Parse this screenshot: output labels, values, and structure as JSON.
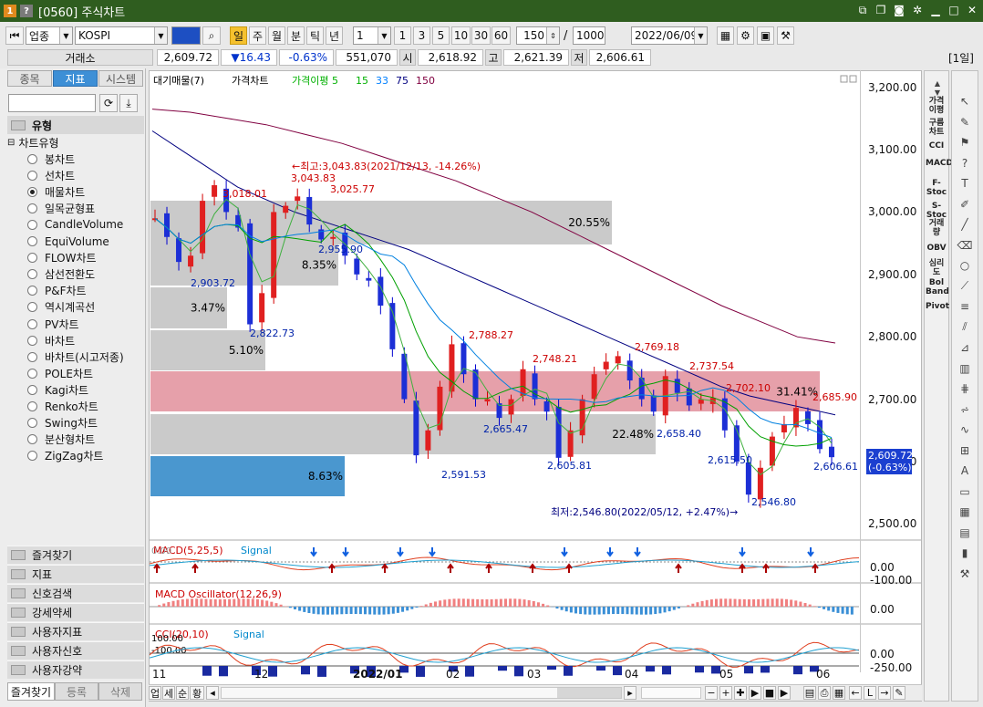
{
  "window": {
    "title": "[0560] 주식차트",
    "icon_left": "1",
    "icon_help": "?"
  },
  "toolbar": {
    "category": "업종",
    "symbol": "KOSPI",
    "period_selected": "일",
    "periods": [
      "일",
      "주",
      "월",
      "분",
      "틱",
      "년"
    ],
    "minute_select": "1",
    "intervals": [
      "1",
      "3",
      "5",
      "10",
      "30",
      "60"
    ],
    "count": "150",
    "count_sep": "/",
    "count_total": "1000",
    "date": "2022/06/09",
    "period_code": "[1일]"
  },
  "quote": {
    "exchange_label": "거래소",
    "price": "2,609.72",
    "change": "▼16.43",
    "change_pct": "-0.63%",
    "volume": "551,070",
    "open_label": "시",
    "open": "2,618.92",
    "high_label": "고",
    "high": "2,621.39",
    "low_label": "저",
    "low": "2,606.61"
  },
  "left_panel": {
    "tabs": [
      "종목",
      "지표",
      "시스템"
    ],
    "active_tab": "지표",
    "section_title": "유형",
    "tree_root": "차트유형",
    "items": [
      "봉차트",
      "선차트",
      "매물차트",
      "일목균형표",
      "CandleVolume",
      "EquiVolume",
      "FLOW차트",
      "삼선전환도",
      "P&F차트",
      "역시계곡선",
      "PV차트",
      "바차트",
      "바차트(시고저종)",
      "POLE차트",
      "Kagi차트",
      "Renko차트",
      "Swing차트",
      "분산형차트",
      "ZigZag차트"
    ],
    "selected_item": "매물차트",
    "bottom_sections": [
      "즐겨찾기",
      "지표",
      "신호검색",
      "강세약세",
      "사용자지표",
      "사용자신호",
      "사용자강약"
    ],
    "footer_tabs": [
      "즐겨찾기",
      "등록",
      "삭제"
    ]
  },
  "chart": {
    "legend": [
      "대기매물(7)",
      "가격차트",
      "가격이평 5",
      "15",
      "33",
      "75",
      "150"
    ],
    "legend_colors": [
      "#000000",
      "#000000",
      "#00b000",
      "#00b000",
      "#0080ff",
      "#000080",
      "#800040"
    ],
    "annotation_high": "←최고:3,043.83(2021/12/13, -14.26%)",
    "annotation_low": "최저:2,546.80(2022/05/12, +2.47%)→",
    "price_labels": [
      "3,018.01",
      "3,043.83",
      "3,025.77",
      "2,955.90",
      "2,903.72",
      "2,822.73",
      "2,788.27",
      "2,748.21",
      "2,769.18",
      "2,737.54",
      "2,702.10",
      "2,685.90",
      "2,665.47",
      "2,591.53",
      "2,605.81",
      "2,658.40",
      "2,615.50",
      "2,546.80",
      "2,606.61"
    ],
    "profile_pcts": [
      "20.55%",
      "8.35%",
      "3.47%",
      "5.10%",
      "31.41%",
      "22.48%",
      "8.63%"
    ],
    "current_price": "2,609.72",
    "current_pct": "(-0.63%)",
    "y_ticks": [
      "3,200.00",
      "3,100.00",
      "3,000.00",
      "2,900.00",
      "2,800.00",
      "2,700.00",
      "2,600.00",
      "2,500.00"
    ],
    "x_ticks": [
      "11",
      "12",
      "2022/01",
      "02",
      "03",
      "04",
      "05",
      "06"
    ]
  },
  "panels": {
    "macd": {
      "title": "MACD(5,25,5)",
      "signal": "Signal",
      "zero": "0.00",
      "ticks": [
        "0.00",
        "-100.00"
      ]
    },
    "osc": {
      "title": "MACD Oscillator(12,26,9)",
      "ticks": [
        "0.00"
      ]
    },
    "cci": {
      "title": "CCI(20,10)",
      "signal": "Signal",
      "top": "100.00",
      "mid": "-100.00",
      "ticks": [
        "0.00",
        "-250.00"
      ]
    }
  },
  "right_tools": [
    "가격이평",
    "구름차트",
    "CCI",
    "MACD",
    "F-Stoc",
    "S-Stoc",
    "거래량",
    "OBV",
    "심리도",
    "Bol Band",
    "Pivot"
  ],
  "bottom_buttons": [
    "업",
    "세",
    "순",
    "황"
  ],
  "chart_data": {
    "type": "line",
    "title": "",
    "x": [
      "11",
      "12",
      "2022/01",
      "02",
      "03",
      "04",
      "05",
      "06"
    ],
    "ylim": [
      2480,
      3220
    ],
    "series": [
      {
        "name": "가격차트",
        "values": [
          2990,
          2960,
          2920,
          2930,
          3018,
          3043,
          3000,
          2975,
          2820,
          2870,
          3000,
          3010,
          3025,
          2980,
          2956,
          2960,
          2930,
          2900,
          2890,
          2850,
          2780,
          2700,
          2610,
          2650,
          2720,
          2788,
          2740,
          2700,
          2700,
          2670,
          2700,
          2748,
          2700,
          2680,
          2606,
          2650,
          2700,
          2740,
          2760,
          2769,
          2730,
          2700,
          2680,
          2737,
          2710,
          2690,
          2700,
          2702,
          2650,
          2600,
          2547,
          2590,
          2640,
          2660,
          2686,
          2660,
          2620,
          2607
        ]
      },
      {
        "name": "75",
        "values": [
          3130,
          3100,
          3070,
          3040,
          3020,
          3000,
          2985,
          2970,
          2955,
          2940,
          2920,
          2900,
          2880,
          2860,
          2840,
          2820,
          2800,
          2780,
          2760,
          2740,
          2720,
          2705,
          2695,
          2685,
          2675
        ]
      },
      {
        "name": "150",
        "values": [
          3165,
          3160,
          3150,
          3140,
          3125,
          3110,
          3090,
          3070,
          3050,
          3025,
          3000,
          2970,
          2940,
          2910,
          2880,
          2850,
          2825,
          2800,
          2790
        ]
      }
    ]
  }
}
